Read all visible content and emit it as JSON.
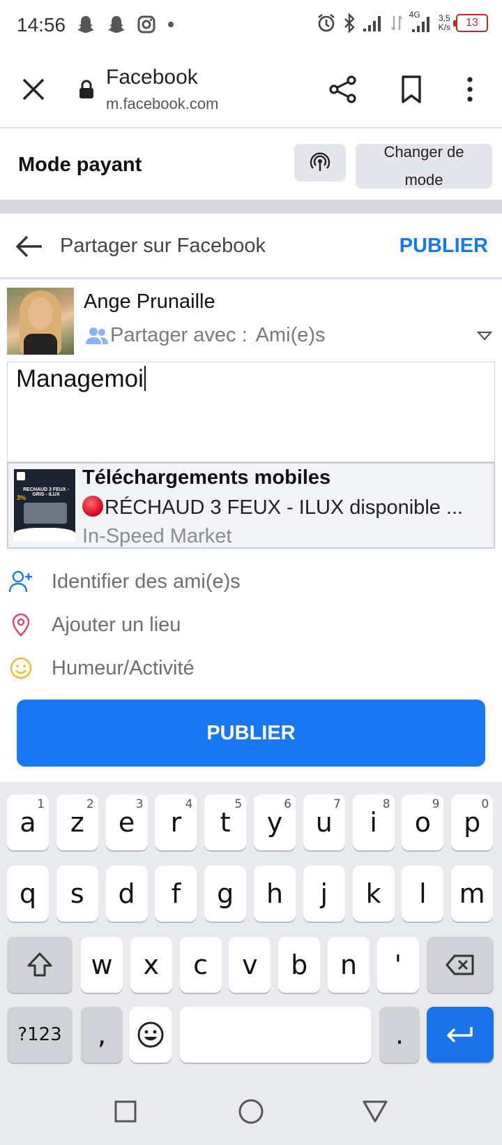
{
  "status_bar": {
    "time": "14:56",
    "network": "4G",
    "speed_value": "3,5",
    "speed_unit": "K/s",
    "battery": "13"
  },
  "browser": {
    "title": "Facebook",
    "url": "m.facebook.com"
  },
  "mode_bar": {
    "title": "Mode payant",
    "change_mode_label": "Changer de mode"
  },
  "share_header": {
    "title": "Partager sur Facebook",
    "publish_label": "PUBLIER"
  },
  "profile": {
    "name": "Ange Prunaille",
    "audience_prefix": "Partager avec :",
    "audience_value": "Ami(e)s"
  },
  "composer": {
    "text": "Managemoi"
  },
  "link_preview": {
    "title": "Téléchargements mobiles",
    "description": "RÉCHAUD 3 FEUX -  ILUX disponible ...",
    "source": "In-Speed Market",
    "thumb_title": "RECHAUD 3 FEUX - GRIS - ILUX",
    "thumb_badge": "3%"
  },
  "options": {
    "tag_friends": "Identifier des ami(e)s",
    "add_place": "Ajouter un lieu",
    "mood": "Humeur/Activité"
  },
  "publish_button": "PUBLIER",
  "keyboard": {
    "row1": [
      {
        "k": "a",
        "h": "1"
      },
      {
        "k": "z",
        "h": "2"
      },
      {
        "k": "e",
        "h": "3"
      },
      {
        "k": "r",
        "h": "4"
      },
      {
        "k": "t",
        "h": "5"
      },
      {
        "k": "y",
        "h": "6"
      },
      {
        "k": "u",
        "h": "7"
      },
      {
        "k": "i",
        "h": "8"
      },
      {
        "k": "o",
        "h": "9"
      },
      {
        "k": "p",
        "h": "0"
      }
    ],
    "row2": [
      "q",
      "s",
      "d",
      "f",
      "g",
      "h",
      "j",
      "k",
      "l",
      "m"
    ],
    "row3": [
      "w",
      "x",
      "c",
      "v",
      "b",
      "n",
      "'"
    ],
    "symbols_label": "?123",
    "comma": ",",
    "period": "."
  },
  "colors": {
    "facebook_blue": "#1877f2",
    "keyboard_bg": "#e8eaed",
    "battery_red": "#c62828"
  }
}
